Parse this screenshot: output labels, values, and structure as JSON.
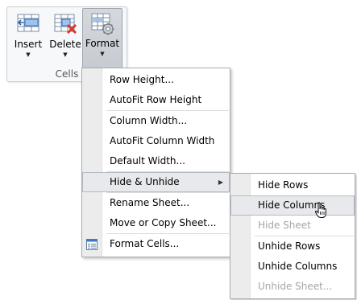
{
  "ribbon": {
    "buttons": [
      {
        "label": "Insert",
        "icon": "insert-cells-icon"
      },
      {
        "label": "Delete",
        "icon": "delete-cells-icon"
      },
      {
        "label": "Format",
        "icon": "format-cells-icon"
      }
    ],
    "group_caption": "Cells"
  },
  "format_menu": {
    "items": [
      {
        "label": "Row Height..."
      },
      {
        "label": "AutoFit Row Height"
      },
      {
        "label": "Column Width..."
      },
      {
        "label": "AutoFit Column Width"
      },
      {
        "label": "Default Width..."
      },
      {
        "label": "Hide & Unhide",
        "submenu_arrow": "▶"
      },
      {
        "label": "Rename Sheet..."
      },
      {
        "label": "Move or Copy Sheet..."
      },
      {
        "label": "Format Cells...",
        "icon": "format-cells-small-icon"
      }
    ]
  },
  "hide_unhide_menu": {
    "items": [
      {
        "label": "Hide Rows"
      },
      {
        "label": "Hide Columns"
      },
      {
        "label": "Hide Sheet",
        "disabled": true
      },
      {
        "label": "Unhide Rows"
      },
      {
        "label": "Unhide Columns"
      },
      {
        "label": "Unhide Sheet...",
        "disabled": true
      }
    ]
  },
  "colors": {
    "highlight_bg": "#e8e9ec",
    "disabled_text": "#a5a5a5",
    "delete_red": "#d63a2a",
    "icon_blue": "#3c78c8"
  }
}
